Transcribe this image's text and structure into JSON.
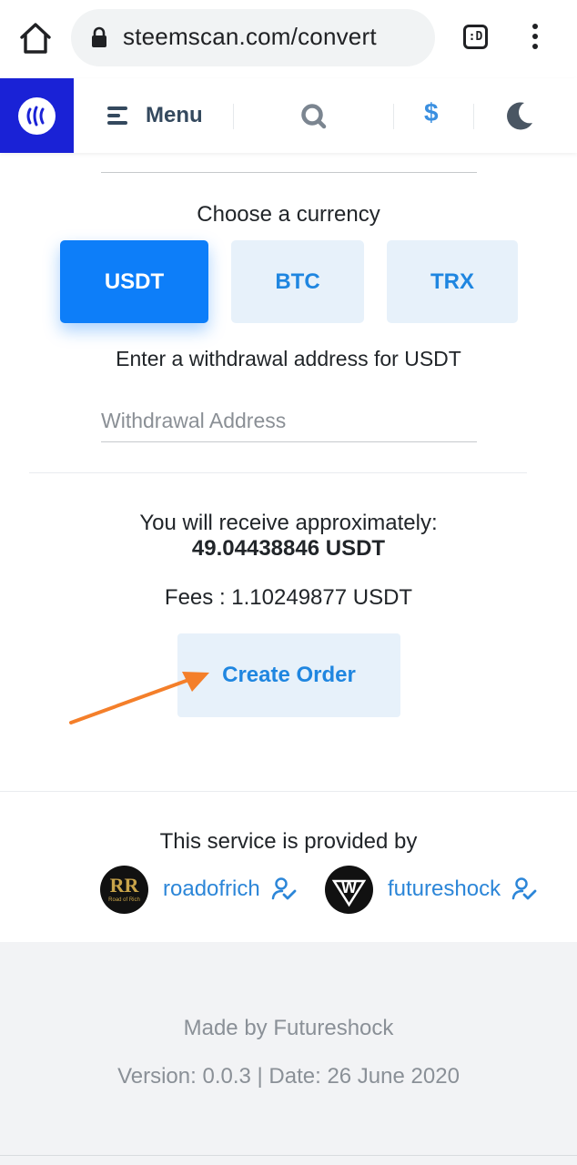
{
  "browser": {
    "url": "steemscan.com/convert",
    "tab_label": ":D"
  },
  "nav": {
    "menu_label": "Menu",
    "currency_symbol": "$"
  },
  "convert": {
    "choose_currency_label": "Choose a currency",
    "currencies": [
      "USDT",
      "BTC",
      "TRX"
    ],
    "selected_currency": "USDT",
    "address_prompt": "Enter a withdrawal address for USDT",
    "address_placeholder": "Withdrawal Address",
    "address_value": "",
    "receive_label": "You will receive approximately:",
    "receive_amount": "49.04438846 USDT",
    "fees": "Fees : 1.10249877 USDT",
    "create_order_label": "Create Order"
  },
  "providers": {
    "heading": "This service is provided by",
    "items": [
      {
        "name": "roadofrich",
        "avatar_text": "RR",
        "avatar_subtext": "Road of Rich"
      },
      {
        "name": "futureshock",
        "avatar_text": "W"
      }
    ]
  },
  "footer": {
    "made_by": "Made by Futureshock",
    "version_line": "Version: 0.0.3 | Date: 26 June 2020"
  },
  "colors": {
    "brand_blue": "#1a22d6",
    "primary": "#0d7ef9",
    "link": "#2c86d8",
    "light_btn": "#e7f1fa",
    "arrow": "#f47f2a"
  }
}
